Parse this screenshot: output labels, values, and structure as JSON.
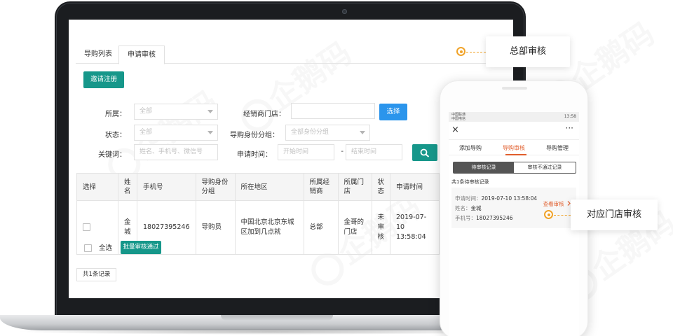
{
  "admin": {
    "tabs": [
      {
        "label": "导购列表"
      },
      {
        "label": "申请审核"
      }
    ],
    "invite_button": "邀请注册",
    "filters": {
      "belong_label": "所属：",
      "belong_value": "全部",
      "dealer_label": "经销商门店：",
      "dealer_value": "",
      "select_button": "选择",
      "status_label": "状态：",
      "status_value": "全部",
      "group_label": "导购身份分组：",
      "group_value": "全部身份分组",
      "keyword_label": "关键词：",
      "keyword_placeholder": "姓名、手机号、微信号",
      "date_label": "申请时间：",
      "start_placeholder": "开始时间",
      "date_sep": "-",
      "end_placeholder": "结束时间"
    },
    "table": {
      "headers": [
        "选择",
        "姓名",
        "手机号",
        "导购身份分组",
        "所在地区",
        "所属经销商",
        "所属门店",
        "状态",
        "申请时间"
      ],
      "rows": [
        {
          "name": "金城",
          "phone": "18027395246",
          "group": "导购员",
          "region": "中国北京北京东城区加到几点就",
          "dealer": "总部",
          "store": "金哥的门店",
          "status": "未审核",
          "time": "2019-07-10 13:58:04"
        }
      ]
    },
    "select_all": "全选",
    "batch_button": "批量审核通过",
    "record_count": "共1条记录"
  },
  "callouts": {
    "hq": "总部审核",
    "store": "对应门店审核"
  },
  "phone": {
    "status_left_top": "中国联通",
    "status_left_bottom": "中国电信",
    "status_right": "13:58",
    "close": "×",
    "more": "···",
    "tabs": [
      "添加导购",
      "导购审核",
      "导购管理"
    ],
    "seg_pending": "待审核记录",
    "seg_rejected": "审核不通过记录",
    "pending_count": "共1条待审核记录",
    "card": {
      "time_label": "申请时间：",
      "time_value": "2019-07-10 13:58:04",
      "name_label": "姓名：",
      "name_value": "金城",
      "phone_label": "手机号：",
      "phone_value": "18027395246",
      "audit_link": "查看审核"
    }
  },
  "icons": {
    "search": "magnifier-icon",
    "chevron": "chevron-right-icon",
    "caret": "caret-down-icon"
  },
  "colors": {
    "primary_green": "#16978a",
    "primary_blue": "#2b95ec",
    "accent_orange": "#f0a32a",
    "phone_accent": "#e15e2c"
  }
}
